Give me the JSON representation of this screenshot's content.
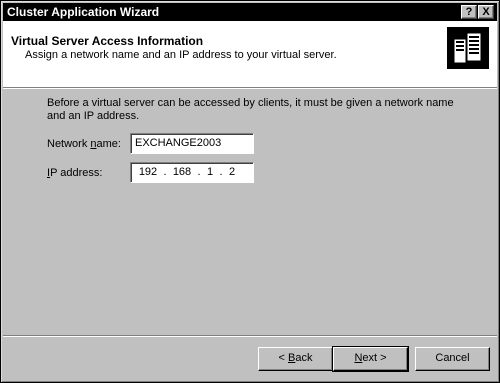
{
  "window": {
    "title": "Cluster Application Wizard",
    "help_label": "?",
    "close_label": "X"
  },
  "header": {
    "title": "Virtual Server Access Information",
    "subtitle": "Assign a network name and an IP address to your virtual server.",
    "icon": "server-icon"
  },
  "body": {
    "intro": "Before a virtual server can be accessed by clients, it must be given a network name and an IP address."
  },
  "fields": {
    "network_name": {
      "label_pre": "Network ",
      "label_mnemonic": "n",
      "label_post": "ame:",
      "value": "EXCHANGE2003"
    },
    "ip_address": {
      "label_pre": "",
      "label_mnemonic": "I",
      "label_post": "P address:",
      "octets": [
        "192",
        "168",
        "1",
        "2"
      ]
    }
  },
  "buttons": {
    "back_pre": "< ",
    "back_mnemonic": "B",
    "back_post": "ack",
    "next_pre": "",
    "next_mnemonic": "N",
    "next_post": "ext >",
    "cancel": "Cancel"
  }
}
